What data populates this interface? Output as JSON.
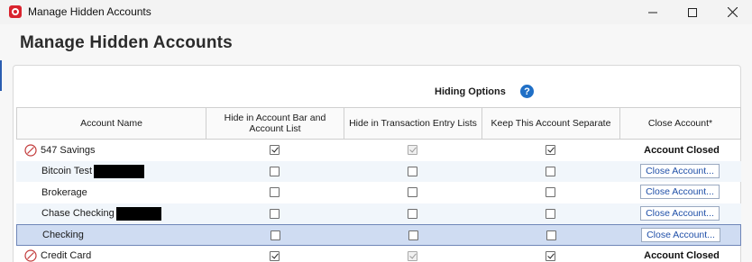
{
  "window": {
    "title": "Manage Hidden Accounts",
    "minimize_glyph": "—",
    "maximize_glyph": "☐",
    "close_glyph": "✕"
  },
  "page": {
    "title": "Manage Hidden Accounts"
  },
  "options": {
    "label": "Hiding Options",
    "help_glyph": "?"
  },
  "columns": [
    "Account Name",
    "Hide in Account Bar and Account List",
    "Hide in Transaction Entry Lists",
    "Keep This Account Separate",
    "Close Account*"
  ],
  "close_button_label": "Close Account...",
  "closed_label": "Account Closed",
  "rows": [
    {
      "name": "547 Savings",
      "closed": true,
      "hide_bar": true,
      "hide_txn": true,
      "txn_disabled": true,
      "separate": true,
      "redacted": false
    },
    {
      "name": "Bitcoin Test",
      "closed": false,
      "hide_bar": false,
      "hide_txn": false,
      "txn_disabled": false,
      "separate": false,
      "redacted": true
    },
    {
      "name": "Brokerage",
      "closed": false,
      "hide_bar": false,
      "hide_txn": false,
      "txn_disabled": false,
      "separate": false,
      "redacted": false
    },
    {
      "name": "Chase Checking",
      "closed": false,
      "hide_bar": false,
      "hide_txn": false,
      "txn_disabled": false,
      "separate": false,
      "redacted": true
    },
    {
      "name": "Checking",
      "closed": false,
      "hide_bar": false,
      "hide_txn": false,
      "txn_disabled": false,
      "separate": false,
      "redacted": false,
      "selected": true
    },
    {
      "name": "Credit Card",
      "closed": true,
      "hide_bar": true,
      "hide_txn": true,
      "txn_disabled": true,
      "separate": true,
      "redacted": false
    }
  ]
}
